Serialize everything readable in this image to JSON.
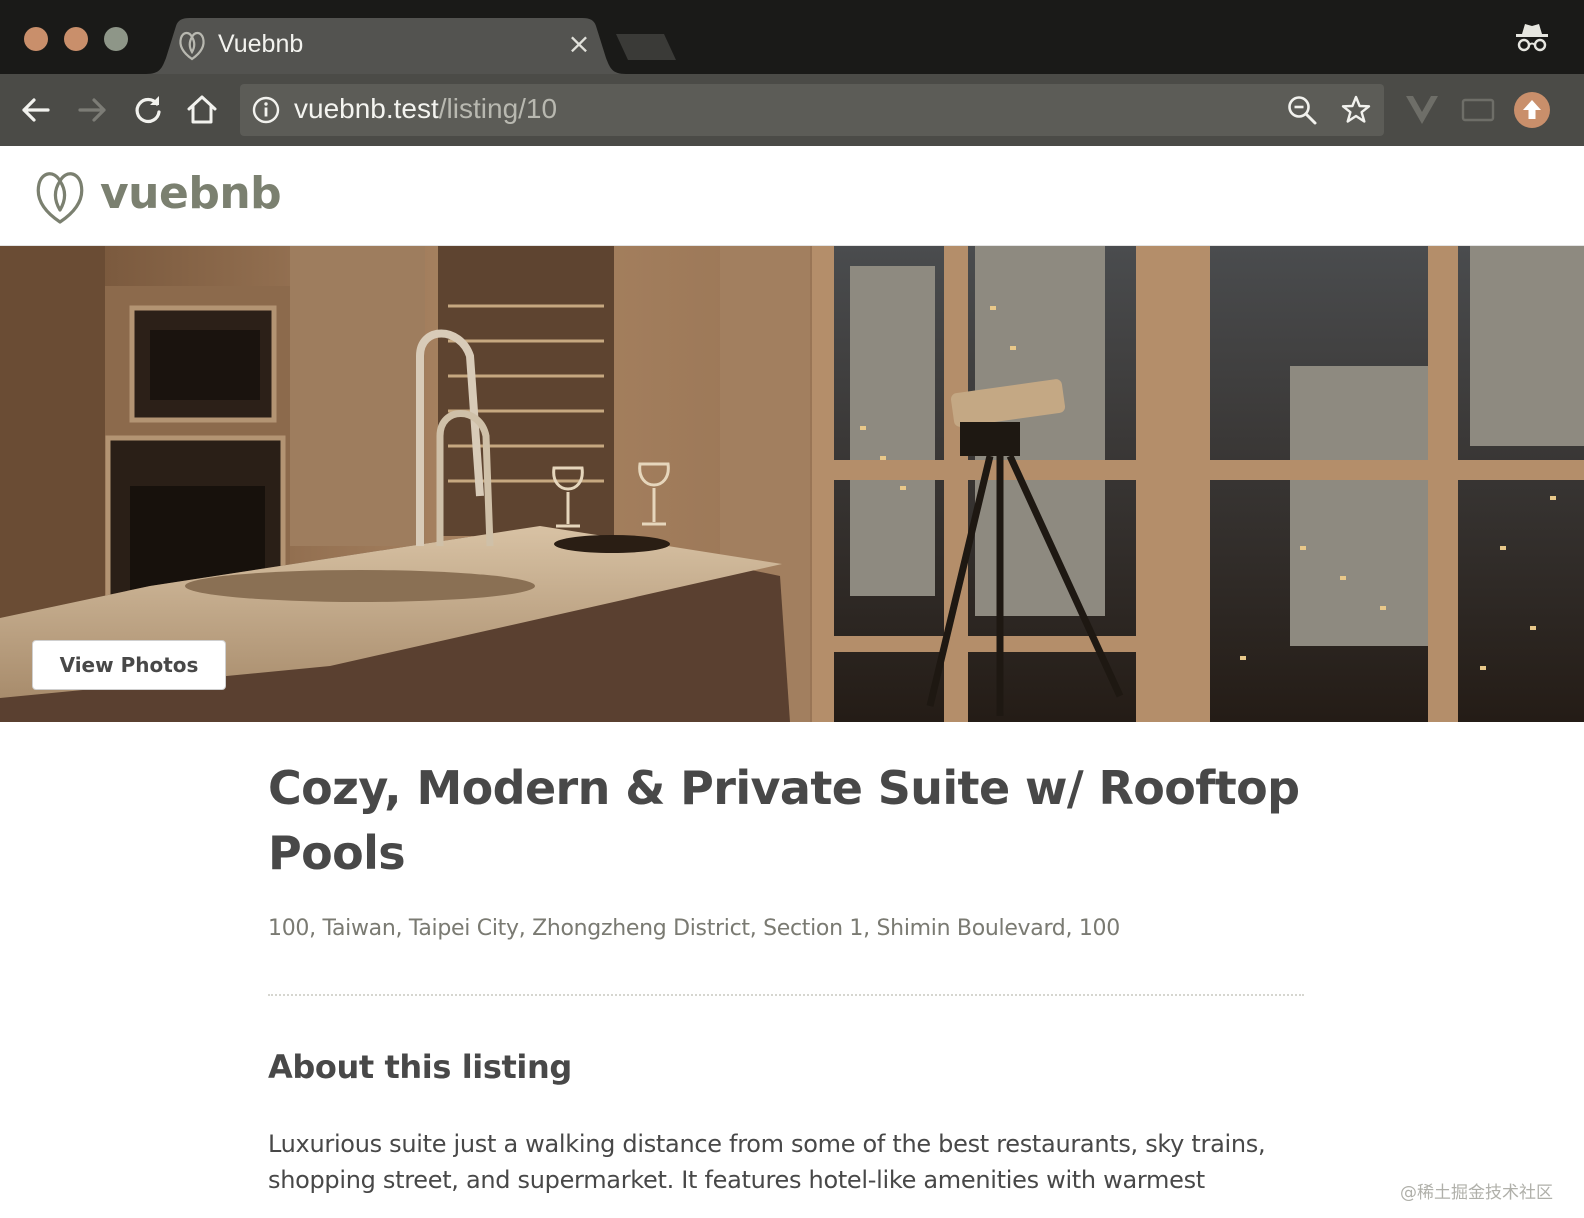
{
  "browser": {
    "tab_title": "Vuebnb",
    "tab_close": "×",
    "url_host": "vuebnb.test",
    "url_path": "/listing/10"
  },
  "site": {
    "name": "vuebnb"
  },
  "hero": {
    "view_photos_label": "View Photos"
  },
  "listing": {
    "title": "Cozy, Modern & Private Suite w/ Rooftop Pools",
    "address": "100, Taiwan, Taipei City, Zhongzheng District, Section 1, Shimin Boulevard, 100",
    "about_heading": "About this listing",
    "about_text": "Luxurious suite just a walking distance from some of the best restaurants, sky trains, shopping street, and supermarket. It features hotel-like amenities with warmest"
  },
  "watermark": "@稀土掘金技术社区",
  "colors": {
    "brand": "#7b8070",
    "accent": "#c98f6b",
    "chrome_dark": "#1a1a18",
    "toolbar": "#4b4b47"
  }
}
